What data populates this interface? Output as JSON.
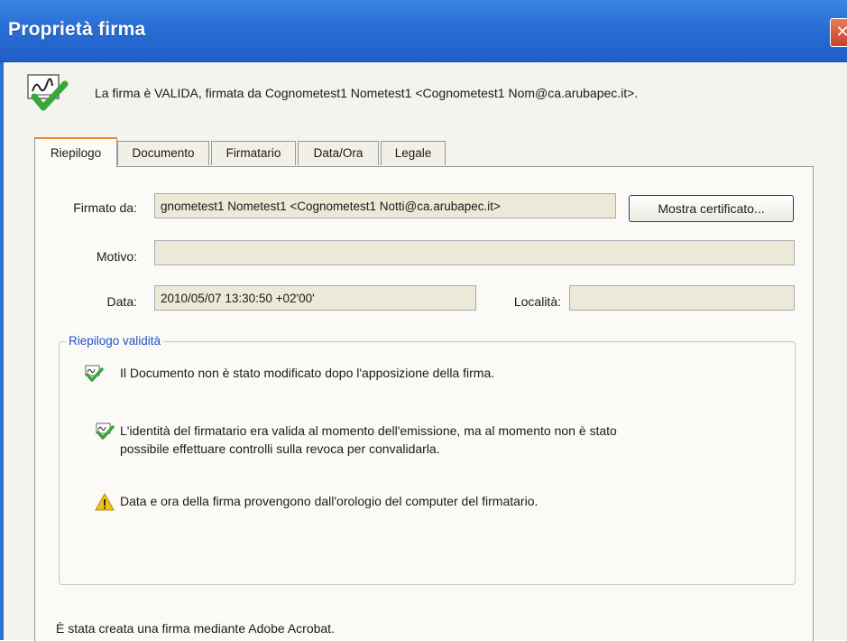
{
  "window": {
    "title": "Proprietà firma",
    "close_glyph": "✕"
  },
  "header": {
    "icon": "signature-valid-icon",
    "message": "La firma è VALIDA, firmata da Cognometest1 Nometest1 <Cognometest1 Nom@ca.arubapec.it>."
  },
  "tabs": [
    "Riepilogo",
    "Documento",
    "Firmatario",
    "Data/Ora",
    "Legale"
  ],
  "active_tab": "Riepilogo",
  "form": {
    "signed_by_label": "Firmato da:",
    "signed_by_value": "gnometest1 Nometest1 <Cognometest1 Notti@ca.arubapec.it>",
    "show_certificate_label": "Mostra certificato...",
    "reason_label": "Motivo:",
    "reason_value": "",
    "date_label": "Data:",
    "date_value": "2010/05/07 13:30:50 +02'00'",
    "location_label": "Località:",
    "location_value": ""
  },
  "validity": {
    "title": "Riepilogo validità",
    "items": [
      {
        "icon": "signature-check-icon",
        "text": "Il Documento non è stato modificato dopo l'apposizione della firma."
      },
      {
        "icon": "signature-check-icon",
        "text": "L'identità del firmatario era valida al momento dell'emissione, ma al momento non è stato",
        "text2": "possibile effettuare controlli sulla revoca per convalidarla."
      },
      {
        "icon": "warning-icon",
        "text": "Data e ora della firma provengono dall'orologio del computer del firmatario."
      }
    ]
  },
  "footer": {
    "text": "È stata creata una firma mediante Adobe Acrobat."
  },
  "colors": {
    "titlebar": "#2a6fd6",
    "dialog_bg": "#f4f3ee",
    "field_bg": "#ece9d8",
    "group_title": "#1f54c8",
    "active_tab_accent": "#e68b2c",
    "check_green": "#3aa63a",
    "warning_yellow": "#f2c418"
  }
}
